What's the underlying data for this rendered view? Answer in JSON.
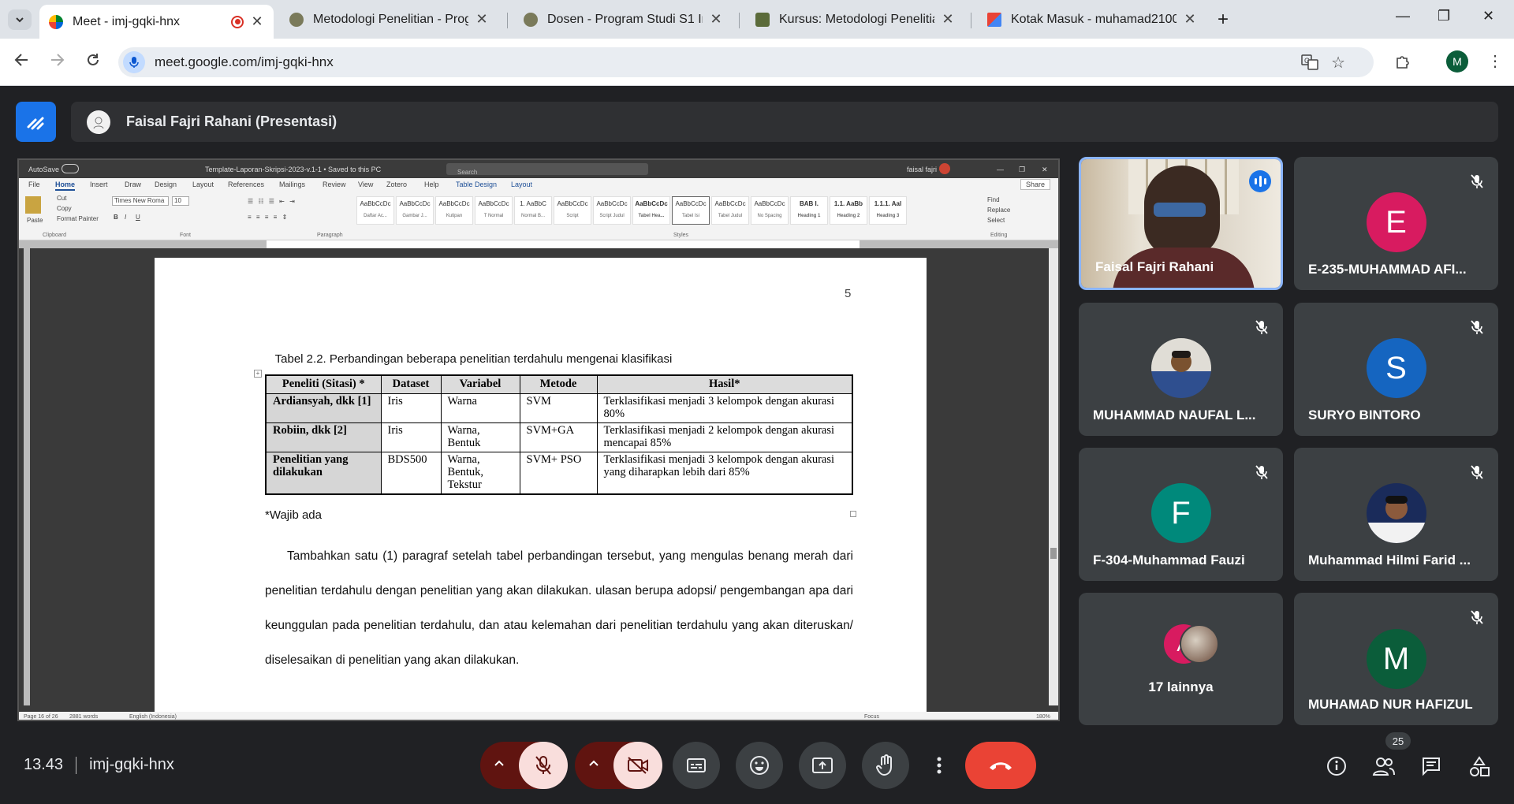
{
  "browser": {
    "tabs": [
      {
        "title": "Meet - imj-gqki-hnx",
        "active": true
      },
      {
        "title": "Metodologi Penelitian - Prograr",
        "active": false
      },
      {
        "title": "Dosen - Program Studi S1 Infor",
        "active": false
      },
      {
        "title": "Kursus: Metodologi Penelitian (",
        "active": false
      },
      {
        "title": "Kotak Masuk - muhamad21000",
        "active": false
      }
    ],
    "url": "meet.google.com/imj-gqki-hnx",
    "profile_initial": "M"
  },
  "meet": {
    "presenter_bar": "Faisal Fajri Rahani (Presentasi)",
    "time": "13.43",
    "meeting_code": "imj-gqki-hnx",
    "participants_count": "25",
    "participants": [
      {
        "name": "Faisal Fajri Rahani",
        "speaking": true
      },
      {
        "name": "E-235-MUHAMMAD AFI...",
        "initial": "E",
        "color": "#d81b60",
        "muted": true
      },
      {
        "name": "MUHAMMAD NAUFAL L...",
        "muted": true
      },
      {
        "name": "SURYO BINTORO",
        "initial": "S",
        "color": "#1565c0",
        "muted": true
      },
      {
        "name": "F-304-Muhammad Fauzi",
        "initial": "F",
        "color": "#00897b",
        "muted": true
      },
      {
        "name": "Muhammad Hilmi Farid ...",
        "muted": true
      },
      {
        "name": "17 lainnya",
        "initial": "A",
        "color": "#d81b60"
      },
      {
        "name": "MUHAMAD NUR HAFIZUL",
        "initial": "M",
        "color": "#0b5d3a",
        "muted": true
      }
    ]
  },
  "word": {
    "title": "Template-Laporan-Skripsi-2023-v.1-1 • Saved to this PC",
    "autosave": "AutoSave",
    "search": "Search",
    "user": "faisal fajri",
    "share": "Share",
    "menu": [
      "File",
      "Home",
      "Insert",
      "Draw",
      "Design",
      "Layout",
      "References",
      "Mailings",
      "Review",
      "View",
      "Zotero",
      "Help",
      "Table Design",
      "Layout"
    ],
    "ribbon": {
      "paste": "Paste",
      "cut": "Cut",
      "copy": "Copy",
      "format_painter": "Format Painter",
      "font": "Times New Roma",
      "size": "10",
      "groups": [
        "Clipboard",
        "Font",
        "Paragraph",
        "Styles",
        "Editing"
      ],
      "styles": [
        {
          "sample": "AaBbCcDc",
          "name": "Daftar Ac..."
        },
        {
          "sample": "AaBbCcDc",
          "name": "Gambar J..."
        },
        {
          "sample": "AaBbCcDc",
          "name": "Kutipan"
        },
        {
          "sample": "AaBbCcDc",
          "name": "T Normal"
        },
        {
          "sample": "1. AaBbC",
          "name": "Normal B..."
        },
        {
          "sample": "AaBbCcDc",
          "name": "Script"
        },
        {
          "sample": "AaBbCcDc",
          "name": "Script Judul"
        },
        {
          "sample": "AaBbCcDc",
          "name": "Tabel Hea..."
        },
        {
          "sample": "AaBbCcDc",
          "name": "Tabel Isi"
        },
        {
          "sample": "AaBbCcDc",
          "name": "Tabel Judul"
        },
        {
          "sample": "AaBbCcDc",
          "name": "No Spacing"
        },
        {
          "sample": "BAB I.",
          "name": "Heading 1"
        },
        {
          "sample": "1.1. AaBb",
          "name": "Heading 2"
        },
        {
          "sample": "1.1.1. Aal",
          "name": "Heading 3"
        }
      ],
      "find": "Find",
      "replace": "Replace",
      "select": "Select"
    },
    "status": {
      "page": "Page 16 of 26",
      "words": "2881 words",
      "lang": "English (Indonesia)",
      "focus": "Focus",
      "zoom": "180%"
    }
  },
  "document": {
    "page_number": "5",
    "caption": "Tabel 2.2. Perbandingan beberapa penelitian terdahulu mengenai klasifikasi",
    "table": {
      "headers": [
        "Peneliti (Sitasi) *",
        "Dataset",
        "Variabel",
        "Metode",
        "Hasil*"
      ],
      "rows": [
        [
          "Ardiansyah, dkk [1]",
          "Iris",
          "Warna",
          "SVM",
          "Terklasifikasi menjadi 3 kelompok dengan akurasi 80%"
        ],
        [
          "Robiin, dkk [2]",
          "Iris",
          "Warna, Bentuk",
          "SVM+GA",
          "Terklasifikasi menjadi 2 kelompok dengan akurasi mencapai 85%"
        ],
        [
          "Penelitian yang dilakukan",
          "BDS500",
          "Warna, Bentuk, Tekstur",
          "SVM+ PSO",
          "Terklasifikasi menjadi 3 kelompok dengan akurasi yang diharapkan lebih dari 85%"
        ]
      ]
    },
    "footnote": "*Wajib ada",
    "paragraph": "Tambahkan satu (1) paragraf setelah tabel perbandingan tersebut, yang mengulas benang merah dari penelitian terdahulu dengan penelitian yang akan dilakukan. ulasan berupa adopsi/ pengembangan apa dari keunggulan pada penelitian terdahulu, dan atau kelemahan dari penelitian terdahulu yang akan diteruskan/ diselesaikan di penelitian yang akan dilakukan."
  }
}
